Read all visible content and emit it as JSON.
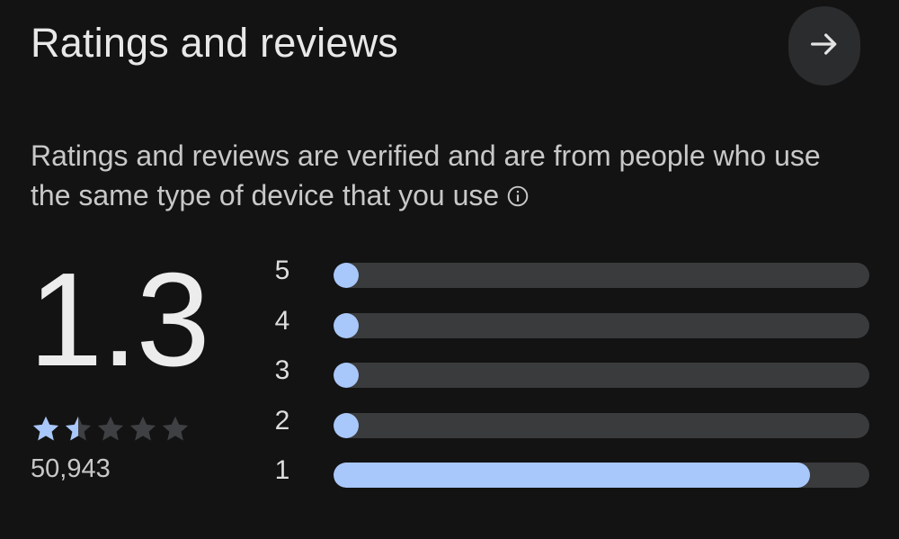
{
  "header": {
    "title": "Ratings and reviews",
    "arrow_icon": "arrow-right-icon"
  },
  "description": {
    "text": "Ratings and reviews are verified and are from people who use the same type of device that you use",
    "info_icon": "info-icon"
  },
  "summary": {
    "average": "1.3",
    "stars_filled": 1.5,
    "stars_total": 5,
    "review_count": "50,943"
  },
  "histogram": [
    {
      "label": "5",
      "fraction": 0.0
    },
    {
      "label": "4",
      "fraction": 0.0
    },
    {
      "label": "3",
      "fraction": 0.0
    },
    {
      "label": "2",
      "fraction": 0.0
    },
    {
      "label": "1",
      "fraction": 0.89
    }
  ],
  "colors": {
    "background": "#131313",
    "accent": "#a8c7fa",
    "track": "#3a3b3d",
    "star_empty": "#3f4043"
  }
}
